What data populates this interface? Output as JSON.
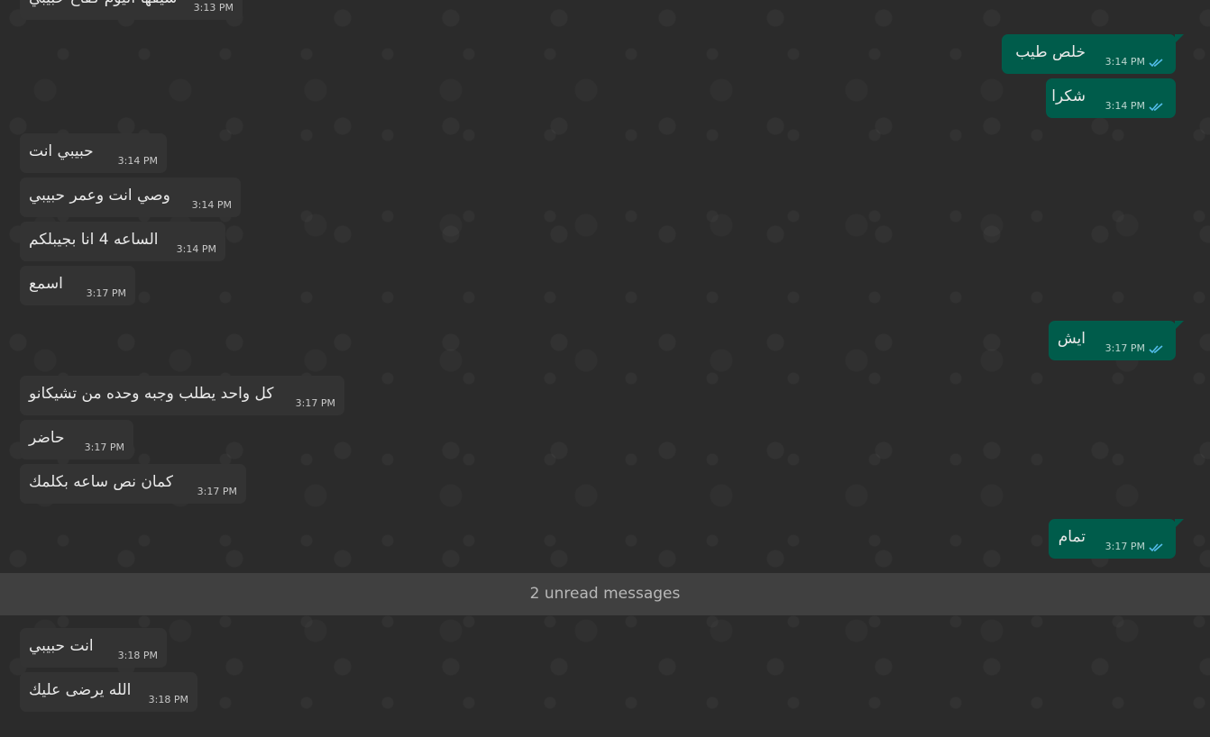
{
  "messages": [
    {
      "id": "m0",
      "direction": "in",
      "text": "شيفها اليوم كفاح حبيبي",
      "time": "3:13 PM"
    },
    {
      "id": "m1",
      "direction": "out",
      "text": "خلص طيب",
      "time": "3:14 PM",
      "status_icon": "double-check-read-icon"
    },
    {
      "id": "m2",
      "direction": "out",
      "text": "شكرا",
      "time": "3:14 PM",
      "status_icon": "double-check-read-icon"
    },
    {
      "id": "m3",
      "direction": "in",
      "text": "حبيبي انت",
      "time": "3:14 PM"
    },
    {
      "id": "m4",
      "direction": "in",
      "text": "وصي انت وعمر حبيبي",
      "time": "3:14 PM"
    },
    {
      "id": "m5",
      "direction": "in",
      "text": "الساعه 4 انا بجيبلكم",
      "time": "3:14 PM"
    },
    {
      "id": "m6",
      "direction": "in",
      "text": "اسمع",
      "time": "3:17 PM"
    },
    {
      "id": "m7",
      "direction": "out",
      "text": "ايش",
      "time": "3:17 PM",
      "status_icon": "double-check-read-icon"
    },
    {
      "id": "m8",
      "direction": "in",
      "text": "كل واحد يطلب وجبه وحده من تشيكانو",
      "time": "3:17 PM"
    },
    {
      "id": "m9",
      "direction": "in",
      "text": "حاضر",
      "time": "3:17 PM"
    },
    {
      "id": "m10",
      "direction": "in",
      "text": "كمان نص ساعه بكلمك",
      "time": "3:17 PM"
    },
    {
      "id": "m11",
      "direction": "out",
      "text": "تمام",
      "time": "3:17 PM",
      "status_icon": "double-check-read-icon"
    },
    {
      "id": "m12",
      "direction": "in",
      "text": "انت حبيبي",
      "time": "3:18 PM"
    },
    {
      "id": "m13",
      "direction": "in",
      "text": "الله يرضى عليك",
      "time": "3:18 PM"
    }
  ],
  "unread_divider": {
    "label": "2 unread messages"
  },
  "colors": {
    "chat_background": "#2b2b2b",
    "incoming_bubble": "#333333",
    "outgoing_bubble": "#005c4b",
    "read_check": "#53bdeb"
  }
}
